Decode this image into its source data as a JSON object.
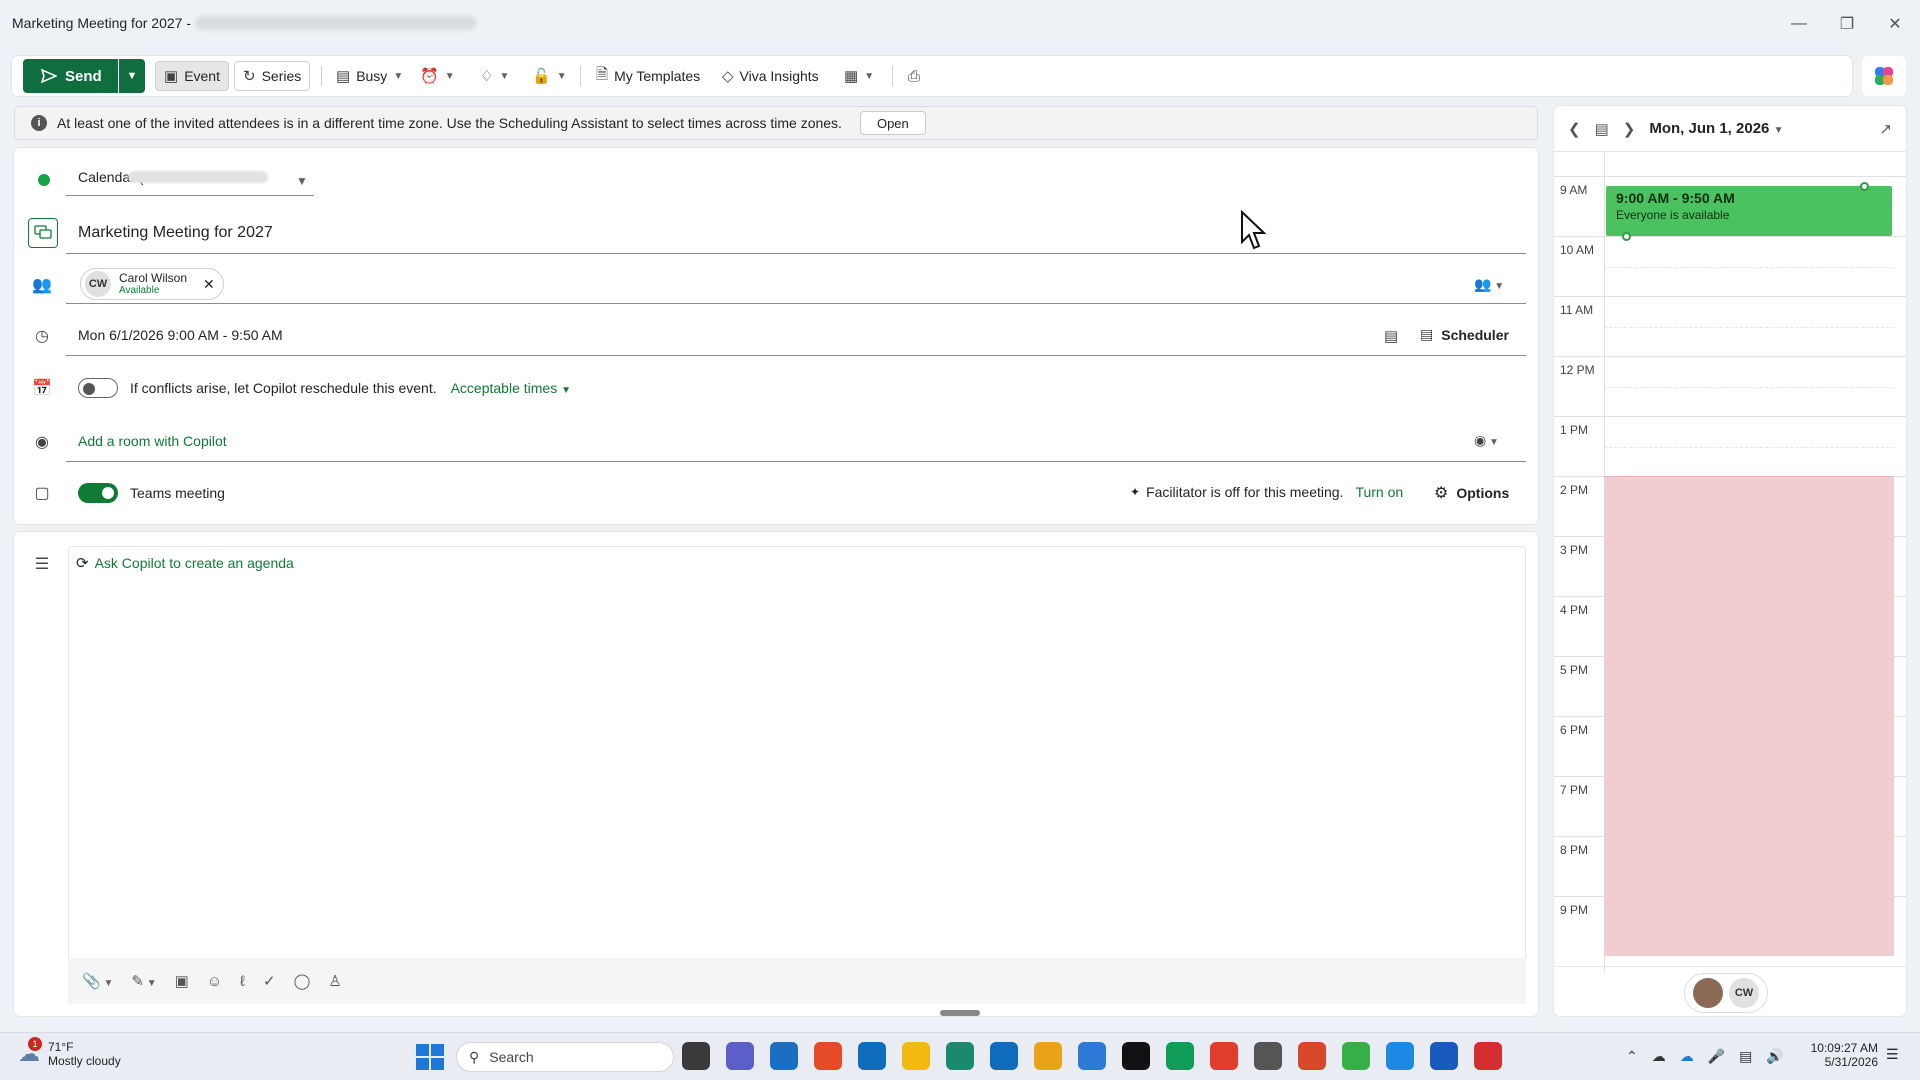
{
  "window": {
    "title": "Marketing Meeting for 2027 -"
  },
  "toolbar": {
    "send_label": "Send",
    "event_label": "Event",
    "series_label": "Series",
    "busy_label": "Busy",
    "my_templates_label": "My Templates",
    "viva_insights_label": "Viva Insights"
  },
  "infobar": {
    "message": "At least one of the invited attendees is in a different time zone. Use the Scheduling Assistant to select times across time zones.",
    "open_label": "Open"
  },
  "form": {
    "calendar_label": "Calendar (",
    "title_value": "Marketing Meeting for 2027",
    "attendee": {
      "initials": "CW",
      "name": "Carol Wilson",
      "status": "Available"
    },
    "datetime": "Mon 6/1/2026 9:00 AM - 9:50 AM",
    "scheduler_label": "Scheduler",
    "reschedule_text": "If conflicts arise, let Copilot reschedule this event.",
    "acceptable_times": "Acceptable times",
    "room_label": "Add a room with Copilot",
    "teams_label": "Teams meeting",
    "facilitator_text": "Facilitator is off for this meeting.",
    "turn_on": "Turn on",
    "options_label": "Options",
    "agenda_label": "Ask Copilot to create an agenda"
  },
  "side_panel": {
    "date_label": "Mon, Jun 1, 2026",
    "hours": [
      "9 AM",
      "10 AM",
      "11 AM",
      "12 PM",
      "1 PM",
      "2 PM",
      "3 PM",
      "4 PM",
      "5 PM",
      "6 PM",
      "7 PM",
      "8 PM",
      "9 PM"
    ],
    "event_time": "9:00 AM - 9:50 AM",
    "event_subtitle": "Everyone is available",
    "busy_from_hour": "2 PM",
    "footer_avatar_initials": "CW",
    "colors": {
      "event": "#4bc25f",
      "busy": "#f2cdd0"
    }
  },
  "taskbar": {
    "weather_temp": "71°F",
    "weather_desc": "Mostly cloudy",
    "weather_badge": "1",
    "search_placeholder": "Search",
    "time": "10:09:27 AM",
    "date": "5/31/2026"
  }
}
